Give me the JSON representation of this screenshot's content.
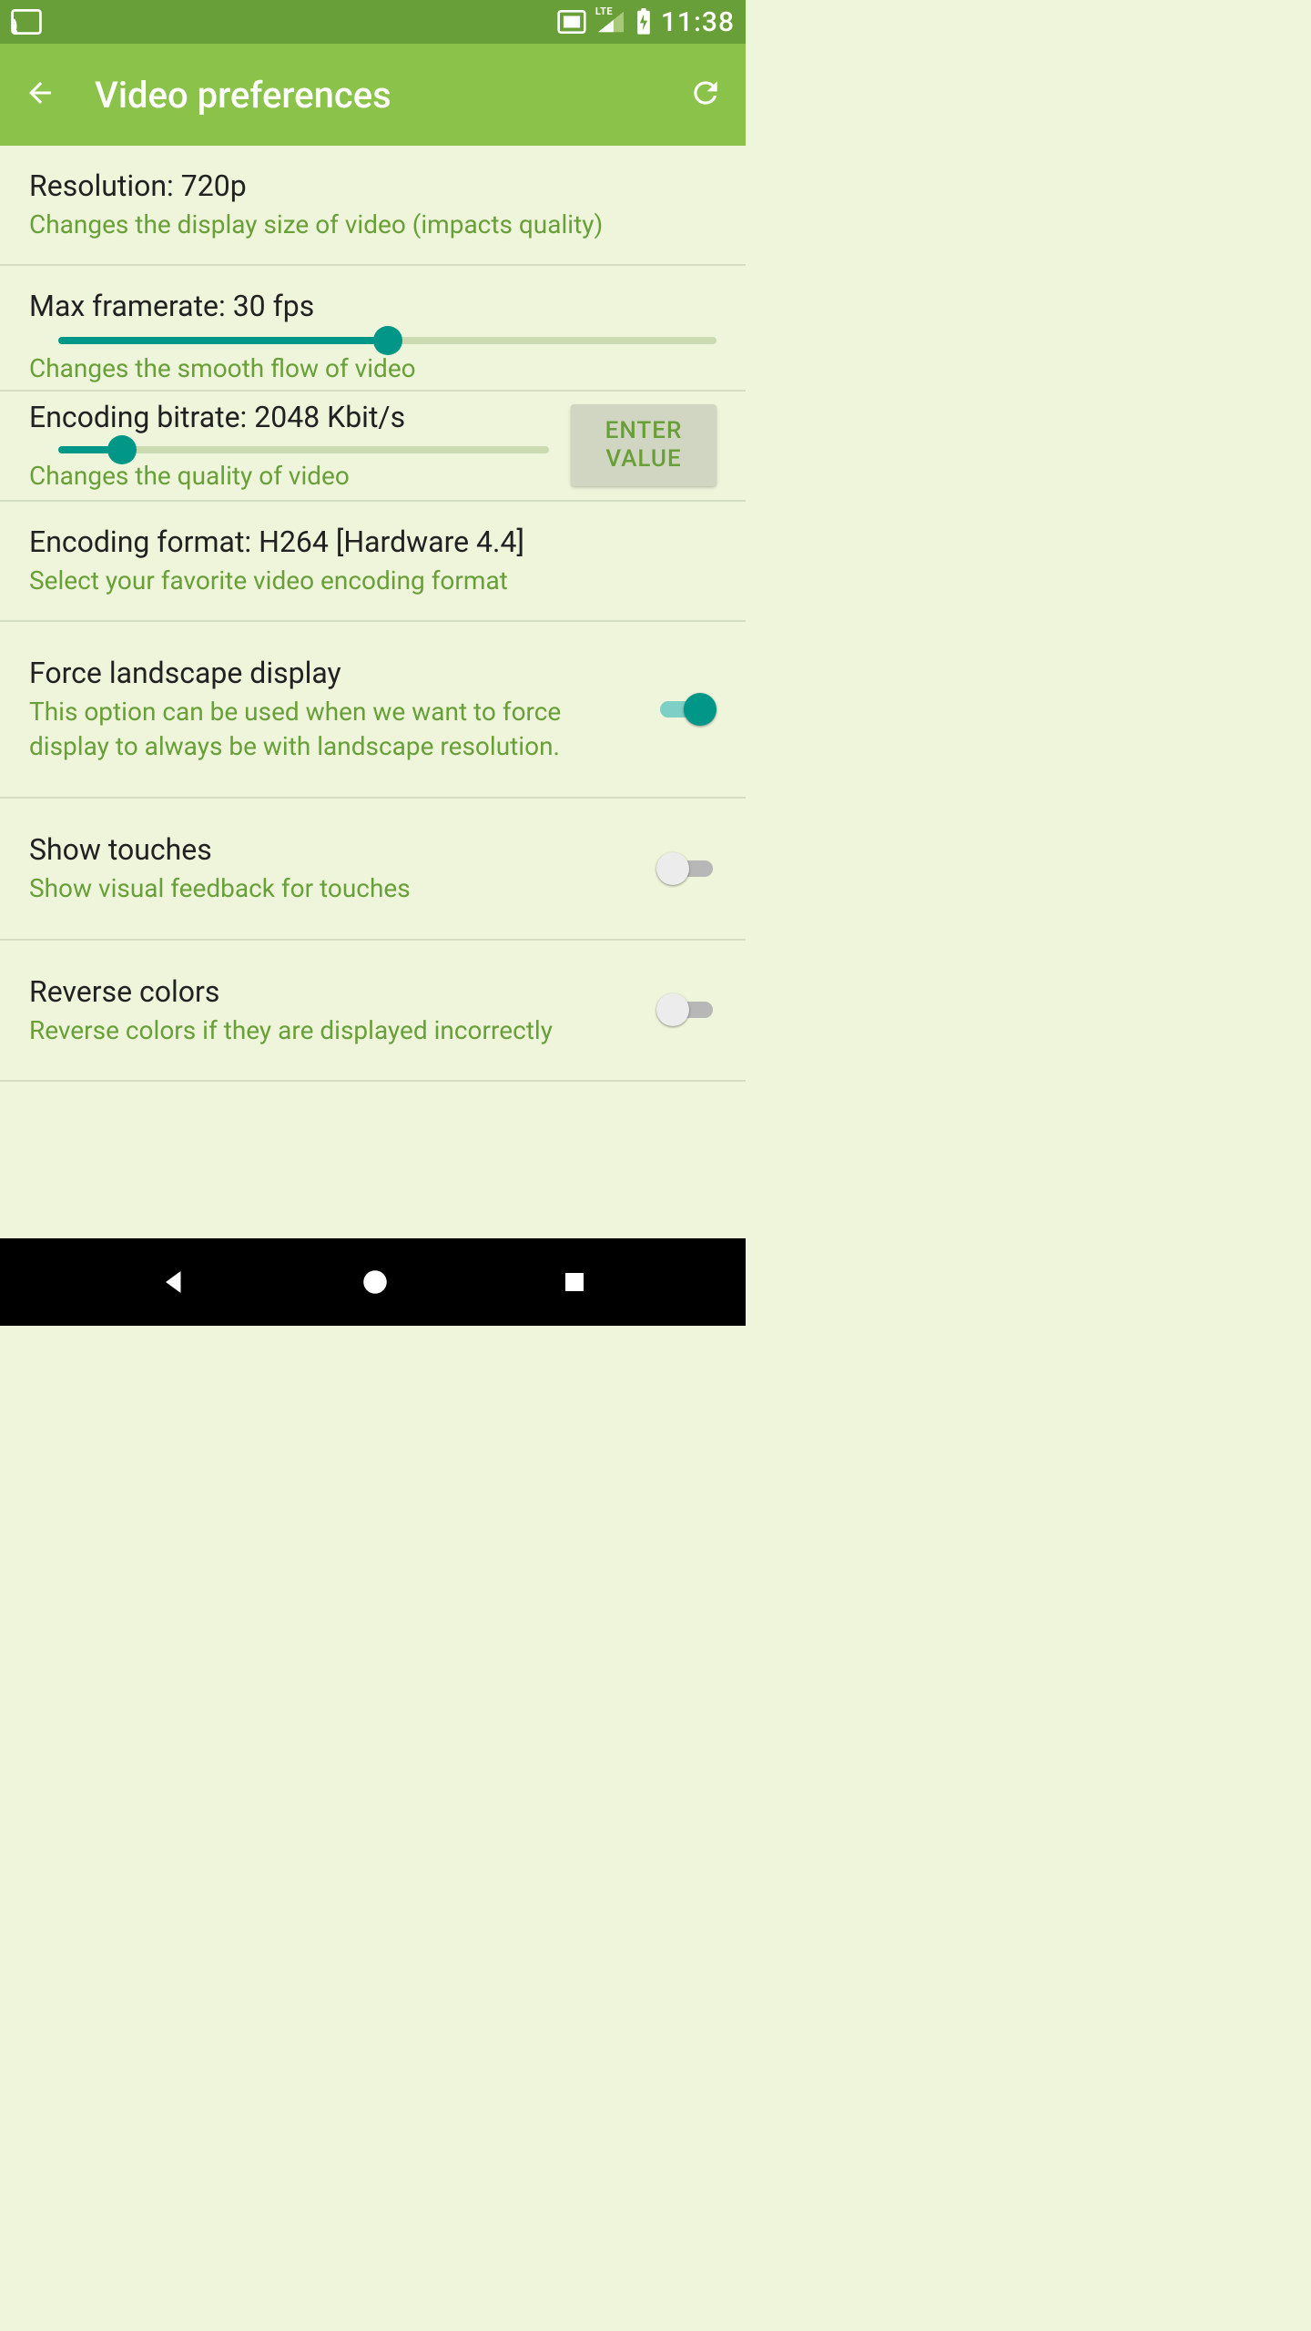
{
  "status_bar": {
    "time": "11:38"
  },
  "app_bar": {
    "title": "Video preferences"
  },
  "resolution": {
    "title": "Resolution: 720p",
    "subtitle": "Changes the display size of video (impacts quality)"
  },
  "framerate": {
    "title": "Max framerate: 30 fps",
    "subtitle": "Changes the smooth flow of video",
    "slider_percent": 50
  },
  "bitrate": {
    "title": "Encoding bitrate: 2048 Kbit/s",
    "subtitle": "Changes the quality of video",
    "slider_percent": 13,
    "button_line1": "ENTER",
    "button_line2": "VALUE"
  },
  "encoding": {
    "title": "Encoding format: H264 [Hardware 4.4]",
    "subtitle": "Select your favorite video encoding format"
  },
  "landscape": {
    "title": "Force landscape display",
    "subtitle": "This option can be used when we want to force display to always be with landscape resolution.",
    "on": true
  },
  "touches": {
    "title": "Show touches",
    "subtitle": "Show visual feedback for touches",
    "on": false
  },
  "reverse": {
    "title": "Reverse colors",
    "subtitle": "Reverse colors if they are displayed incorrectly",
    "on": false
  }
}
